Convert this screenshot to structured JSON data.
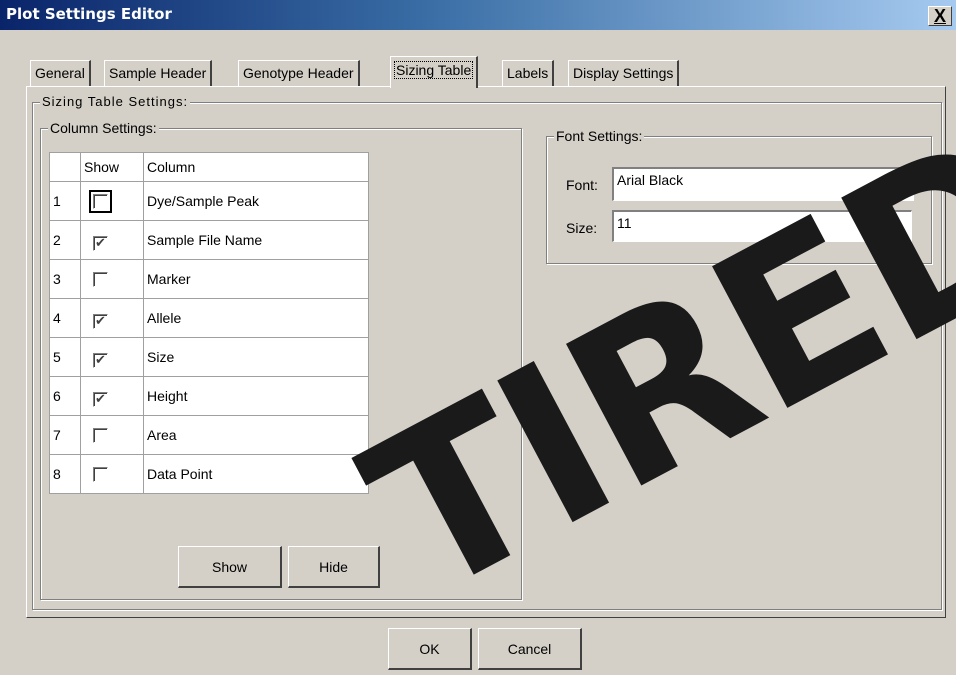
{
  "window": {
    "title": "Plot Settings Editor",
    "close_glyph": "X"
  },
  "tabs": [
    {
      "label": "General",
      "active": false
    },
    {
      "label": "Sample Header",
      "active": false
    },
    {
      "label": "Genotype Header",
      "active": false
    },
    {
      "label": "Sizing Table",
      "active": true
    },
    {
      "label": "Labels",
      "active": false
    },
    {
      "label": "Display Settings",
      "active": false
    }
  ],
  "panel": {
    "group_title": "Sizing Table Settings:",
    "column_settings": {
      "title": "Column Settings:",
      "headers": {
        "num": "",
        "show": "Show",
        "column": "Column"
      },
      "rows": [
        {
          "num": "1",
          "checked": false,
          "column": "Dye/Sample Peak"
        },
        {
          "num": "2",
          "checked": true,
          "column": "Sample File Name"
        },
        {
          "num": "3",
          "checked": false,
          "column": "Marker"
        },
        {
          "num": "4",
          "checked": true,
          "column": "Allele"
        },
        {
          "num": "5",
          "checked": true,
          "column": "Size"
        },
        {
          "num": "6",
          "checked": true,
          "column": "Height"
        },
        {
          "num": "7",
          "checked": false,
          "column": "Area"
        },
        {
          "num": "8",
          "checked": false,
          "column": "Data Point"
        }
      ],
      "show_button": "Show",
      "hide_button": "Hide"
    },
    "font_settings": {
      "title": "Font Settings:",
      "font_label": "Font:",
      "font_value": "Arial Black",
      "size_label": "Size:",
      "size_value": "11"
    }
  },
  "buttons": {
    "ok": "OK",
    "cancel": "Cancel"
  },
  "watermark": "TIRED",
  "colors": {
    "face": "#d4d0c8",
    "title_start": "#0a246a",
    "title_end": "#a6caf0"
  },
  "icons": {
    "checkbox_checked": "check-icon",
    "dropdown": "chevron-down-icon",
    "close": "close-icon"
  }
}
